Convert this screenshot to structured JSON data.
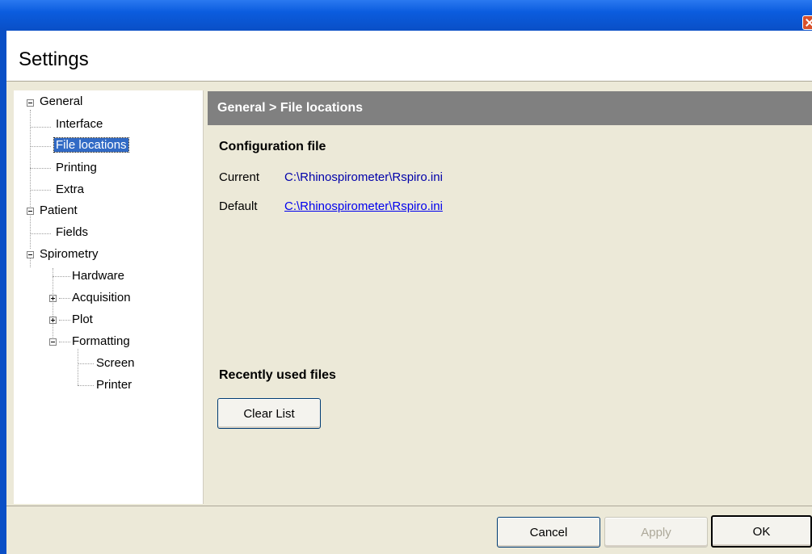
{
  "window": {
    "title": "Settings"
  },
  "tree": {
    "items": [
      {
        "label": "General"
      },
      {
        "label": "Interface"
      },
      {
        "label": "File locations"
      },
      {
        "label": "Printing"
      },
      {
        "label": "Extra"
      },
      {
        "label": "Patient"
      },
      {
        "label": "Fields"
      },
      {
        "label": "Spirometry"
      },
      {
        "label": "Hardware"
      },
      {
        "label": "Acquisition"
      },
      {
        "label": "Plot"
      },
      {
        "label": "Formatting"
      },
      {
        "label": "Screen"
      },
      {
        "label": "Printer"
      }
    ],
    "selected": "File locations"
  },
  "content": {
    "breadcrumb": "General > File locations",
    "config_section": "Configuration file",
    "current_label": "Current",
    "current_value": "C:\\Rhinospirometer\\Rspiro.ini",
    "default_label": "Default",
    "default_value": "C:\\Rhinospirometer\\Rspiro.ini",
    "recent_section": "Recently used files",
    "clear_button": "Clear List"
  },
  "footer": {
    "cancel": "Cancel",
    "apply": "Apply",
    "ok": "OK"
  }
}
